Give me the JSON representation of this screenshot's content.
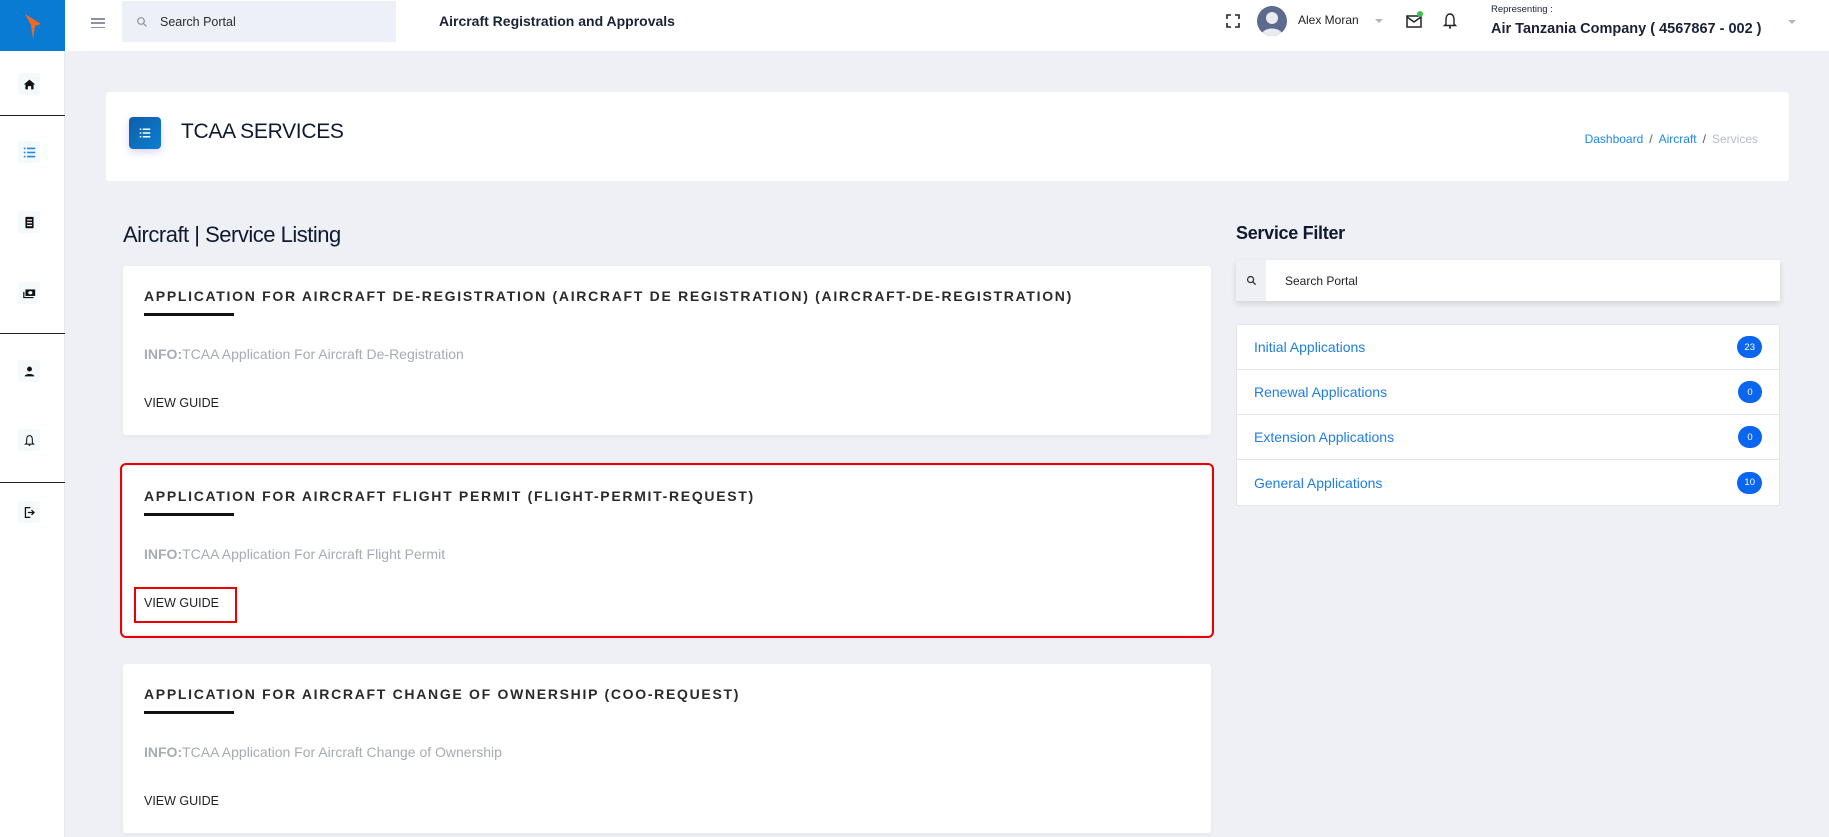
{
  "header": {
    "search_placeholder": "Search Portal",
    "page_heading": "Aircraft Registration and Approvals",
    "user_name": "Alex Moran",
    "representing_label": "Representing :",
    "representing_value": "Air Tanzania Company ( 4567867 - 002 )",
    "mail_has_notification": true
  },
  "sidebar": {
    "items": [
      {
        "icon": "home-icon"
      },
      {
        "icon": "list-icon",
        "active": true
      },
      {
        "icon": "document-icon"
      },
      {
        "icon": "money-icon"
      },
      {
        "icon": "user-icon"
      },
      {
        "icon": "bell-icon"
      },
      {
        "icon": "logout-icon"
      }
    ]
  },
  "title_card": {
    "title": "TCAA SERVICES",
    "breadcrumb": [
      {
        "label": "Dashboard"
      },
      {
        "label": "Aircraft"
      },
      {
        "label": "Services"
      }
    ],
    "breadcrumb_separator": "/"
  },
  "listing": {
    "title": "Aircraft | Service Listing",
    "services": [
      {
        "title": "APPLICATION FOR AIRCRAFT DE-REGISTRATION (AIRCRAFT DE REGISTRATION) (AIRCRAFT-DE-REGISTRATION)",
        "info_label": "INFO:",
        "info": "TCAA Application For Aircraft De-Registration",
        "guide_label": "VIEW GUIDE"
      },
      {
        "title": "APPLICATION FOR AIRCRAFT FLIGHT PERMIT (FLIGHT-PERMIT-REQUEST)",
        "info_label": "INFO:",
        "info": "TCAA Application For Aircraft Flight Permit",
        "guide_label": "VIEW GUIDE",
        "highlighted": true
      },
      {
        "title": "APPLICATION FOR AIRCRAFT CHANGE OF OWNERSHIP (COO-REQUEST)",
        "info_label": "INFO:",
        "info": "TCAA Application For Aircraft Change of Ownership",
        "guide_label": "VIEW GUIDE"
      }
    ]
  },
  "filter": {
    "title": "Service Filter",
    "search_placeholder": "Search Portal",
    "items": [
      {
        "label": "Initial Applications",
        "count": "23"
      },
      {
        "label": "Renewal Applications",
        "count": "0"
      },
      {
        "label": "Extension Applications",
        "count": "0"
      },
      {
        "label": "General Applications",
        "count": "10"
      }
    ]
  },
  "colors": {
    "brand": "#0a7bd3",
    "logo_accent": "#f26a21",
    "link": "#1e7ee4",
    "badge": "#0a66f0",
    "highlight": "#ee0000"
  }
}
